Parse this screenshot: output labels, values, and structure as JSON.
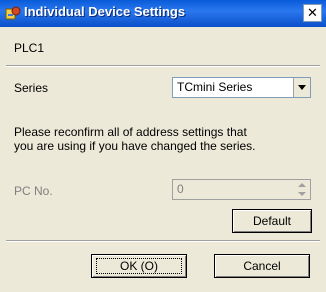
{
  "window": {
    "title": "Individual Device Settings",
    "close_glyph": "✕",
    "icon": "settings-app-icon"
  },
  "device": {
    "name": "PLC1"
  },
  "series": {
    "label": "Series",
    "value": "TCmini Series"
  },
  "notice": {
    "line1": "Please reconfirm all of address settings that",
    "line2": "you are using if you have changed the series."
  },
  "pc_no": {
    "label": "PC No.",
    "value": "0"
  },
  "buttons": {
    "default": "Default",
    "ok": "OK (O)",
    "cancel": "Cancel"
  }
}
